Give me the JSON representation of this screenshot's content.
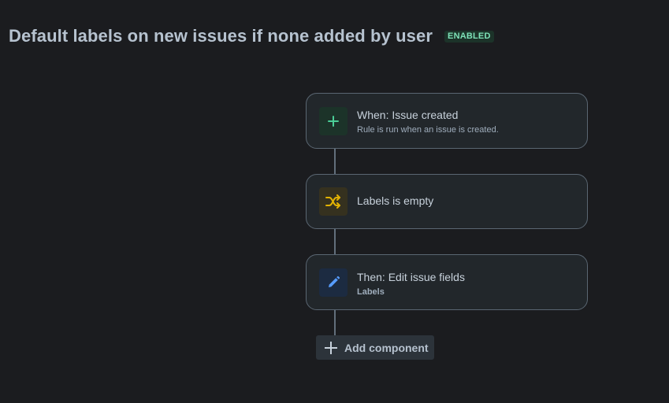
{
  "header": {
    "title": "Default labels on new issues if none added by user",
    "status_badge": "ENABLED"
  },
  "flow": {
    "trigger": {
      "icon": "plus-icon",
      "icon_color": "#4bce97",
      "title": "When: Issue created",
      "subtitle": "Rule is run when an issue is created."
    },
    "condition": {
      "icon": "shuffle-icon",
      "icon_color": "#e2b203",
      "title": "Labels is empty"
    },
    "action": {
      "icon": "pencil-icon",
      "icon_color": "#579dff",
      "title": "Then: Edit issue fields",
      "subtitle": "Labels"
    }
  },
  "add_component": {
    "icon": "plus-icon",
    "label": "Add component"
  },
  "colors": {
    "background": "#1b1c1f",
    "card_bg": "#22272b",
    "card_border": "#5a6672",
    "badge_text": "#7ee2b8",
    "badge_bg": "#1c3329"
  }
}
